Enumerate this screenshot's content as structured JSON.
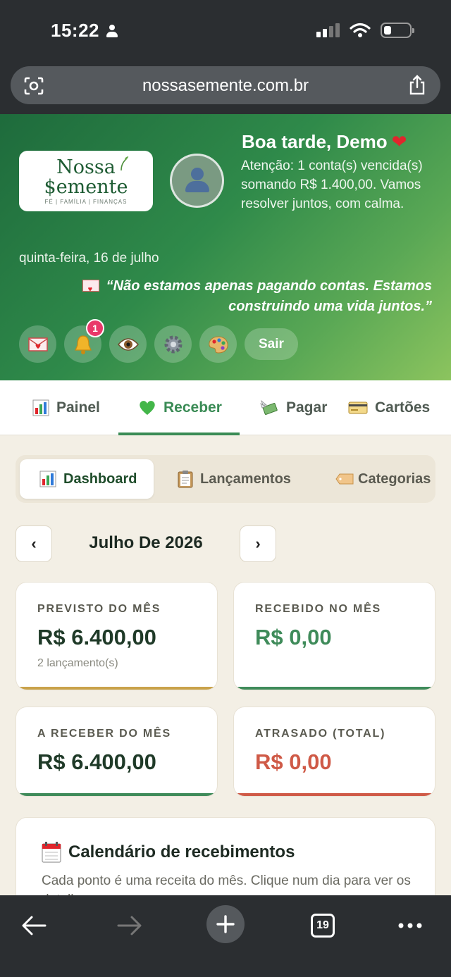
{
  "status": {
    "time": "15:22"
  },
  "browser": {
    "url": "nossasemente.com.br",
    "tabs_count": "19"
  },
  "header": {
    "logo_line1": "Nossa",
    "logo_line2": "$emente",
    "logo_tagline": "FÉ | FAMÍLIA | FINANÇAS",
    "greeting": "Boa tarde, Demo",
    "greeting_emoji": "❤",
    "alert": "Atenção: 1 conta(s) vencida(s) somando R$ 1.400,00. Vamos resolver juntos, com calma.",
    "date": "quinta-feira, 16 de julho",
    "quote": "“Não estamos apenas pagando contas. Estamos construindo uma vida juntos.”",
    "notification_count": "1",
    "logout_label": "Sair"
  },
  "main_tabs": [
    {
      "label": "Painel",
      "icon": "bar-chart-icon"
    },
    {
      "label": "Receber",
      "icon": "green-heart-icon"
    },
    {
      "label": "Pagar",
      "icon": "money-wings-icon"
    },
    {
      "label": "Cartões",
      "icon": "credit-card-icon"
    }
  ],
  "sub_tabs": [
    {
      "label": "Dashboard",
      "icon": "bar-chart-icon"
    },
    {
      "label": "Lançamentos",
      "icon": "clipboard-icon"
    },
    {
      "label": "Categorias",
      "icon": "tag-icon"
    }
  ],
  "month": {
    "title": "Julho De 2026",
    "prev": "‹",
    "next": "›"
  },
  "stats": [
    {
      "label": "PREVISTO DO MÊS",
      "value": "R$ 6.400,00",
      "sub": "2 lançamento(s)",
      "value_color": "#1f3a28",
      "bar_color": "#c9a24a"
    },
    {
      "label": "RECEBIDO NO MÊS",
      "value": "R$ 0,00",
      "sub": "",
      "value_color": "#3f8b5a",
      "bar_color": "#3f8b5a"
    },
    {
      "label": "A RECEBER DO MÊS",
      "value": "R$ 6.400,00",
      "sub": "",
      "value_color": "#1f3a28",
      "bar_color": "#3f8b5a"
    },
    {
      "label": "ATRASADO (TOTAL)",
      "value": "R$ 0,00",
      "sub": "",
      "value_color": "#cf5a47",
      "bar_color": "#cf5a47"
    }
  ],
  "calendar": {
    "title": "Calendário de recebimentos",
    "subtitle": "Cada ponto é uma receita do mês. Clique num dia para ver os detalhes."
  }
}
